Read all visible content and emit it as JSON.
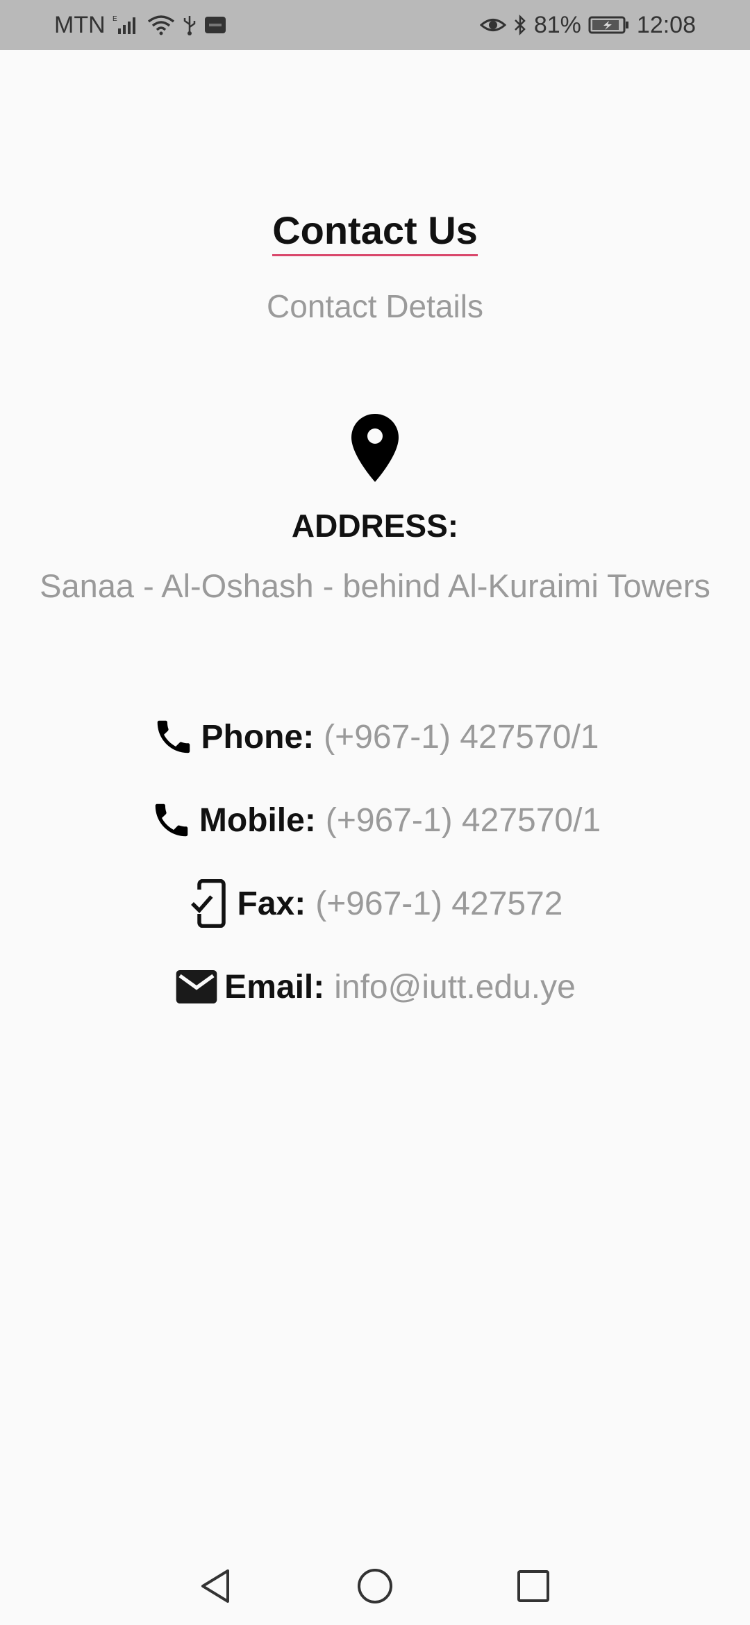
{
  "status_bar": {
    "carrier": "MTN",
    "battery": "81%",
    "time": "12:08"
  },
  "page": {
    "title": "Contact Us",
    "subtitle": "Contact Details"
  },
  "address": {
    "label": "ADDRESS:",
    "value": "Sanaa - Al-Oshash - behind Al-Kuraimi Towers"
  },
  "contacts": [
    {
      "label": "Phone:",
      "value": "(+967-1) 427570/1",
      "icon": "phone-icon"
    },
    {
      "label": "Mobile:",
      "value": "(+967-1) 427570/1",
      "icon": "phone-icon"
    },
    {
      "label": "Fax:",
      "value": "(+967-1) 427572",
      "icon": "phonelink-ring-icon"
    },
    {
      "label": "Email:",
      "value": "info@iutt.edu.ye",
      "icon": "email-icon"
    }
  ],
  "colors": {
    "background": "#fafafa",
    "status_bar": "#b9b9b9",
    "title_underline": "#d9476b",
    "muted_text": "#9a9a9a",
    "strong_text": "#111111"
  }
}
